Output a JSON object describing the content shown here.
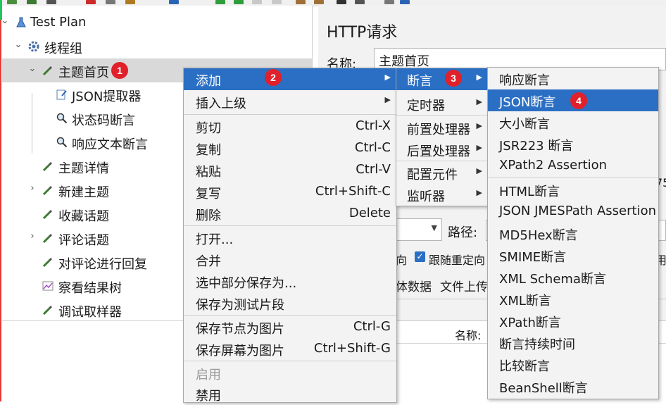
{
  "tree": {
    "root": "Test Plan",
    "thread_group": "线程组",
    "items": [
      {
        "label": "主题首页"
      },
      {
        "label": "JSON提取器"
      },
      {
        "label": "状态码断言"
      },
      {
        "label": "响应文本断言"
      },
      {
        "label": "主题详情"
      },
      {
        "label": "新建主题"
      },
      {
        "label": "收藏话题"
      },
      {
        "label": "评论话题"
      },
      {
        "label": "对评论进行回复"
      },
      {
        "label": "察看结果树"
      },
      {
        "label": "调试取样器"
      }
    ]
  },
  "panel": {
    "title": "HTTP请求",
    "name_label": "名称:",
    "name_value": "主题首页",
    "path_label": "路径:",
    "redirect_suffix": "向",
    "follow_redirects_label": "跟随重定向",
    "follow_redirects_checked": true,
    "body_data_tab": "体数据",
    "file_upload_tab": "文件上传",
    "table_name_header": "名称:",
    "right_edge_number": "75",
    "right_edge_char": "用r"
  },
  "badges": [
    "1",
    "2",
    "3",
    "4"
  ],
  "context_menu": {
    "items": [
      {
        "label": "添加",
        "submenu": true
      },
      {
        "label": "插入上级",
        "submenu": true
      },
      {
        "label": "剪切",
        "shortcut": "Ctrl-X"
      },
      {
        "label": "复制",
        "shortcut": "Ctrl-C"
      },
      {
        "label": "粘贴",
        "shortcut": "Ctrl-V"
      },
      {
        "label": "复写",
        "shortcut": "Ctrl+Shift-C"
      },
      {
        "label": "删除",
        "shortcut": "Delete"
      },
      {
        "label": "打开..."
      },
      {
        "label": "合并"
      },
      {
        "label": "选中部分保存为..."
      },
      {
        "label": "保存为测试片段"
      },
      {
        "label": "保存节点为图片",
        "shortcut": "Ctrl-G"
      },
      {
        "label": "保存屏幕为图片",
        "shortcut": "Ctrl+Shift-G"
      },
      {
        "label": "启用",
        "disabled": true
      },
      {
        "label": "禁用"
      }
    ]
  },
  "add_submenu": {
    "items": [
      {
        "label": "断言"
      },
      {
        "label": "定时器"
      },
      {
        "label": "前置处理器"
      },
      {
        "label": "后置处理器"
      },
      {
        "label": "配置元件"
      },
      {
        "label": "监听器"
      }
    ]
  },
  "assertion_submenu": {
    "items": [
      {
        "label": "响应断言"
      },
      {
        "label": "JSON断言"
      },
      {
        "label": "大小断言"
      },
      {
        "label": "JSR223 断言"
      },
      {
        "label": "XPath2 Assertion"
      },
      {
        "label": "HTML断言"
      },
      {
        "label": "JSON JMESPath Assertion"
      },
      {
        "label": "MD5Hex断言"
      },
      {
        "label": "SMIME断言"
      },
      {
        "label": "XML Schema断言"
      },
      {
        "label": "XML断言"
      },
      {
        "label": "XPath断言"
      },
      {
        "label": "断言持续时间"
      },
      {
        "label": "比较断言"
      },
      {
        "label": "BeanShell断言"
      }
    ]
  },
  "colors": {
    "highlight": "#2b6fc4",
    "badge": "#e0202a",
    "selected_row": "#d9d9d9"
  }
}
